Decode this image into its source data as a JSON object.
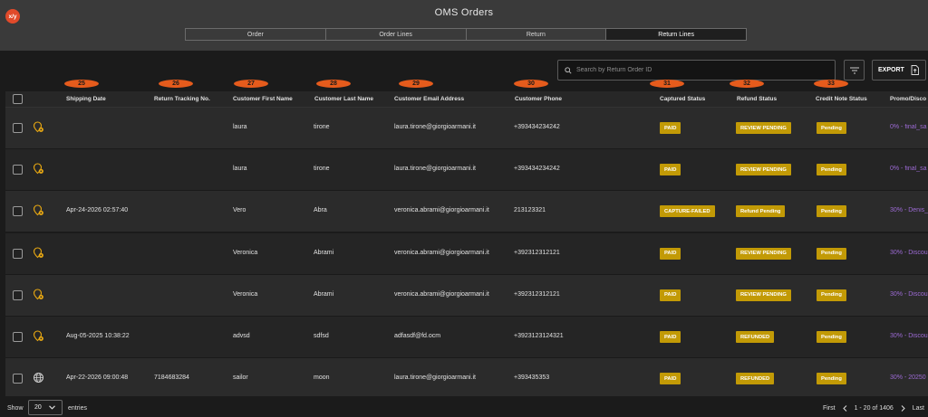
{
  "app": {
    "logo_text": "x/y",
    "title": "OMS Orders"
  },
  "tabs": [
    {
      "label": "Order",
      "active": false
    },
    {
      "label": "Order Lines",
      "active": false
    },
    {
      "label": "Return",
      "active": false
    },
    {
      "label": "Return Lines",
      "active": true
    }
  ],
  "toolbar": {
    "search_placeholder": "Search by Return Order ID",
    "export_label": "EXPORT"
  },
  "column_markers": [
    "25",
    "26",
    "27",
    "28",
    "29",
    "30",
    "31",
    "32",
    "33"
  ],
  "columns": [
    "Shipping Date",
    "Return Tracking No.",
    "Customer First Name",
    "Customer Last Name",
    "Customer Email Address",
    "Customer Phone",
    "Captured Status",
    "Refund Status",
    "Credit Note Status",
    "Promo/Disco"
  ],
  "rows": [
    {
      "icon": "location-pin-icon",
      "shipping_date": "",
      "tracking": "",
      "first": "laura",
      "last": "tirone",
      "email": "laura.tirone@giorgioarmani.it",
      "phone": "+393434234242",
      "captured": "PAID",
      "refund": "REVIEW PENDING",
      "credit": "Pending",
      "promo": "0% - final_sa"
    },
    {
      "icon": "location-pin-icon",
      "shipping_date": "",
      "tracking": "",
      "first": "laura",
      "last": "tirone",
      "email": "laura.tirone@giorgioarmani.it",
      "phone": "+393434234242",
      "captured": "PAID",
      "refund": "REVIEW PENDING",
      "credit": "Pending",
      "promo": "0% - final_sa"
    },
    {
      "icon": "location-pin-icon",
      "shipping_date": "Apr-24-2026 02:57:40",
      "tracking": "",
      "first": "Vero",
      "last": "Abra",
      "email": "veronica.abrami@giorgioarmani.it",
      "phone": "213123321",
      "captured": "CAPTURE-FAILED",
      "refund": "Refund Pending",
      "credit": "Pending",
      "promo": "30% - Denis_"
    },
    {
      "icon": "location-pin-icon",
      "shipping_date": "",
      "tracking": "",
      "first": "Veronica",
      "last": "Abrami",
      "email": "veronica.abrami@giorgioarmani.it",
      "phone": "+392312312121",
      "captured": "PAID",
      "refund": "REVIEW PENDING",
      "credit": "Pending",
      "promo": "30% - Discou"
    },
    {
      "icon": "location-pin-icon",
      "shipping_date": "",
      "tracking": "",
      "first": "Veronica",
      "last": "Abrami",
      "email": "veronica.abrami@giorgioarmani.it",
      "phone": "+392312312121",
      "captured": "PAID",
      "refund": "REVIEW PENDING",
      "credit": "Pending",
      "promo": "30% - Discou"
    },
    {
      "icon": "location-pin-icon",
      "shipping_date": "Aug-05-2025 10:38:22",
      "tracking": "",
      "first": "advsd",
      "last": "sdfsd",
      "email": "adfasdf@fd.ocm",
      "phone": "+3923123124321",
      "captured": "PAID",
      "refund": "REFUNDED",
      "credit": "Pending",
      "promo": "30% - Discou"
    },
    {
      "icon": "globe-icon",
      "shipping_date": "Apr-22-2026 09:00:48",
      "tracking": "7184683284",
      "first": "sailor",
      "last": "moon",
      "email": "laura.tirone@giorgioarmani.it",
      "phone": "+393435353",
      "captured": "PAID",
      "refund": "REFUNDED",
      "credit": "Pending",
      "promo": "30% - 20250"
    }
  ],
  "footer": {
    "show_label": "Show",
    "page_size": "20",
    "entries_label": "entries",
    "first_label": "First",
    "range_text": "1 - 20 of 1406",
    "last_label": "Last"
  },
  "colors": {
    "accent_orange": "#e55b1c",
    "status_gold": "#c29a06",
    "promo_purple": "#9c6ad4",
    "logo_red": "#e14a2a"
  }
}
